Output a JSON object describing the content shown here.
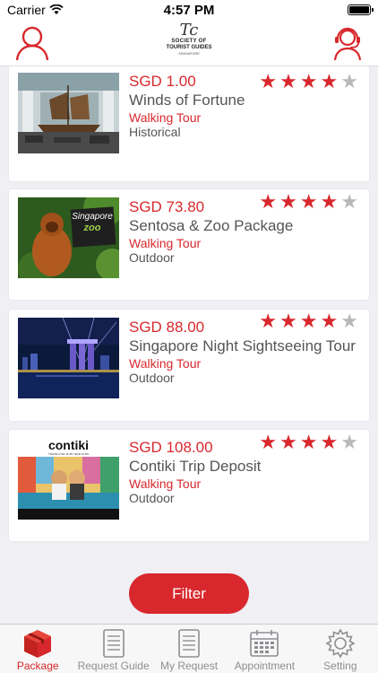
{
  "status_bar": {
    "carrier": "Carrier",
    "time": "4:57 PM"
  },
  "header": {
    "logo_mark": "Tc",
    "logo_line1": "SOCIETY OF",
    "logo_line2": "TOURIST GUIDES",
    "logo_line3": "SINGAPORE"
  },
  "colors": {
    "accent": "#d8282d",
    "text": "#555555",
    "star_off": "#b8b8b8"
  },
  "tours": [
    {
      "price": "SGD 1.00",
      "title": "Winds of Fortune",
      "category": "Walking Tour",
      "tag": "Historical",
      "rating": 4,
      "image": "ship-museum"
    },
    {
      "price": "SGD 73.80",
      "title": "Sentosa & Zoo Package",
      "category": "Walking Tour",
      "tag": "Outdoor",
      "rating": 4,
      "image": "orangutan-zoo"
    },
    {
      "price": "SGD 88.00",
      "title": "Singapore Night Sightseeing Tour",
      "category": "Walking Tour",
      "tag": "Outdoor",
      "rating": 4,
      "image": "night-skyline"
    },
    {
      "price": "SGD 108.00",
      "title": "Contiki Trip Deposit",
      "category": "Walking Tour",
      "tag": "Outdoor",
      "rating": 4,
      "image": "contiki-ad"
    }
  ],
  "thumb_text": {
    "zoo_sign": "Singapore",
    "zoo_sign2": "zoo",
    "contiki_logo": "contiki",
    "contiki_tagline": "TRAVEL FOR 18-35 YEAR OLDS"
  },
  "filter_label": "Filter",
  "tabs": [
    {
      "label": "Package",
      "icon": "package-box-icon",
      "active": true
    },
    {
      "label": "Request Guide",
      "icon": "document-icon",
      "active": false
    },
    {
      "label": "My Request",
      "icon": "document-icon",
      "active": false
    },
    {
      "label": "Appointment",
      "icon": "calendar-icon",
      "active": false
    },
    {
      "label": "Setting",
      "icon": "gear-icon",
      "active": false
    }
  ]
}
